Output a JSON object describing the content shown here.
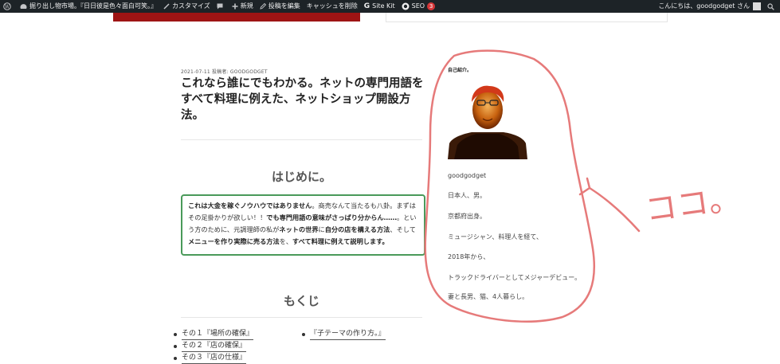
{
  "adminbar": {
    "site_name": "掘り出し物市場。『日日彼是色々面白可笑。』",
    "customize": "カスタマイズ",
    "new": "新規",
    "edit_post": "投稿を編集",
    "clear_cache": "キャッシュを削除",
    "site_kit": "Site Kit",
    "seo": "SEO",
    "seo_count": "3",
    "greeting": "こんにちは、goodgodget さん"
  },
  "post": {
    "date": "2021-07-11",
    "author_prefix": "投稿者:",
    "author": "GOODGODGET",
    "title": "これなら誰にでもわかる。ネットの専門用語をすべて料理に例えた、ネットショップ開設方法。",
    "intro_heading": "はじめに。",
    "toc_heading": "もくじ"
  },
  "notice": {
    "p1": "これは大金を稼ぐノウハウではありません",
    "p2": "。商売なんて当たるも八卦。まずはその足掛かりが欲しい！！",
    "p3": "でも専門用語の意味がさっぱり分からん……",
    "p4": "。という方のために、元調理師の私が",
    "p5": "ネットの世界",
    "p6": "に",
    "p7": "自分の店を構える方法",
    "p8": "、そして",
    "p9": "メニューを作り実際に売る方法",
    "p10": "を、",
    "p11": "すべて料理に例えて説明します。"
  },
  "toc": {
    "left": [
      "その１『場所の確保』",
      "その２『店の確保』",
      "その３『店の仕様』"
    ],
    "right": [
      "『子テーマの作り方。』"
    ]
  },
  "sidebar": {
    "widget_title": "自己紹介。",
    "name": "goodgodget",
    "lines": [
      "日本人、男。",
      "京都府出身。",
      "ミュージシャン、料理人を経て、",
      "2018年から、",
      "トラックドライバーとしてメジャーデビュー。",
      "妻と長男、猫、4人暮らし。"
    ]
  },
  "annotation": {
    "text": "ココ。",
    "color": "#e67a7a"
  }
}
